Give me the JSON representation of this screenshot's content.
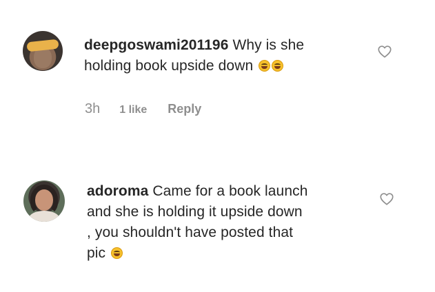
{
  "comments": [
    {
      "username": "deepgoswami201196",
      "text_lines": [
        "Why is she",
        "holding book upside down"
      ],
      "trailing_emojis": [
        "grinning-squinting-face",
        "grinning-squinting-face"
      ],
      "time": "3h",
      "likes": "1 like",
      "reply_label": "Reply",
      "like_icon": "heart-icon"
    },
    {
      "username": "adoroma",
      "text_lines": [
        "Came for a book launch",
        "and she is holding it upside down",
        ", you shouldn't have posted that",
        "pic"
      ],
      "trailing_emojis": [
        "grinning-squinting-face"
      ],
      "like_icon": "heart-icon"
    }
  ],
  "colors": {
    "text": "#262626",
    "meta": "#8e8e8e",
    "heart_outline": "#8e8e8e"
  }
}
